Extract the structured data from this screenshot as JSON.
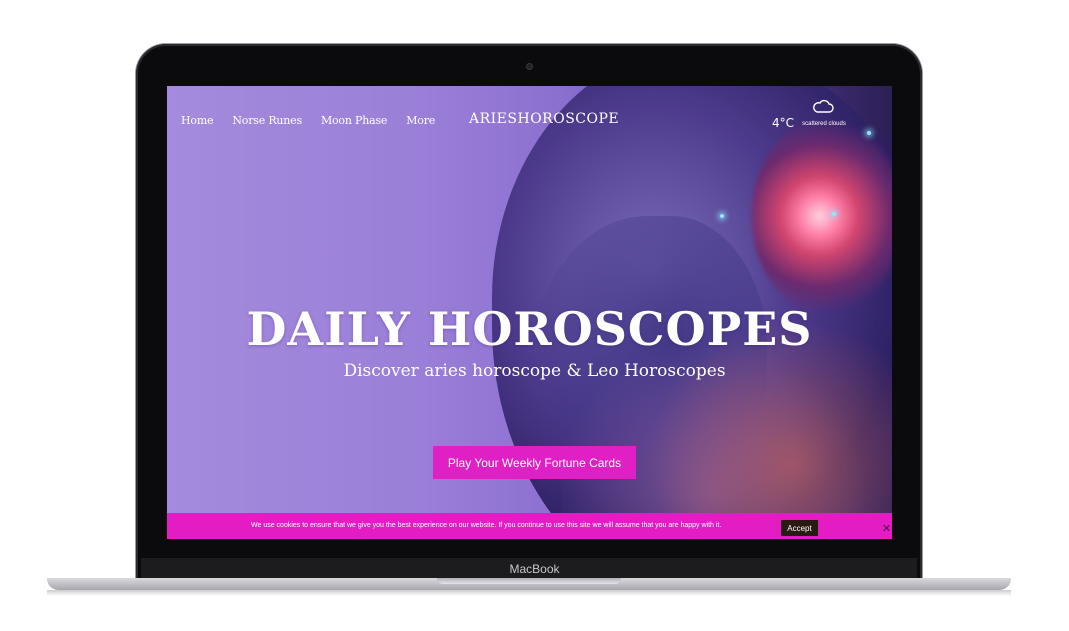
{
  "nav": {
    "items": [
      {
        "label": "Home"
      },
      {
        "label": "Norse Runes"
      },
      {
        "label": "Moon Phase"
      },
      {
        "label": "More"
      }
    ]
  },
  "logo": "ARIESHOROSCOPE",
  "weather": {
    "temp": "4°C",
    "desc": "scattered clouds",
    "icon": "cloud-icon"
  },
  "hero": {
    "title": "DAILY HOROSCOPES",
    "subtitle": "Discover aries horoscope & Leo Horoscopes",
    "cta": "Play Your Weekly Fortune Cards"
  },
  "cookie": {
    "text": "We use cookies to ensure that we give you the best experience on our website. If you continue to use this site we will assume that you are happy with it.",
    "accept": "Accept",
    "close": "✕"
  },
  "device": {
    "brand": "MacBook"
  },
  "colors": {
    "accent": "#e01fc4",
    "hero_bg": "#9a7fd8"
  }
}
